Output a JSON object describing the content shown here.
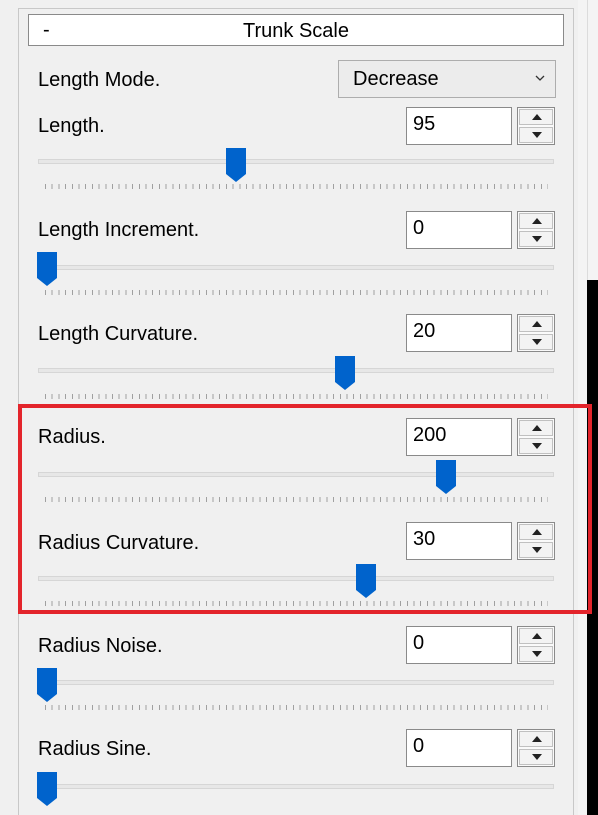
{
  "section": {
    "collapse_symbol": "-",
    "title": "Trunk Scale"
  },
  "length_mode": {
    "label": "Length Mode.",
    "selected": "Decrease",
    "icon": "chevron-down-icon"
  },
  "controls": [
    {
      "label": "Length.",
      "value": "95"
    },
    {
      "label": "Length Increment.",
      "value": "0"
    },
    {
      "label": "Length Curvature.",
      "value": "20"
    },
    {
      "label": "Radius.",
      "value": "200"
    },
    {
      "label": "Radius Curvature.",
      "value": "30"
    },
    {
      "label": "Radius Noise.",
      "value": "0"
    },
    {
      "label": "Radius Sine.",
      "value": "0"
    }
  ],
  "colors": {
    "thumb": "#0063cc",
    "highlight": "#e3242b"
  }
}
